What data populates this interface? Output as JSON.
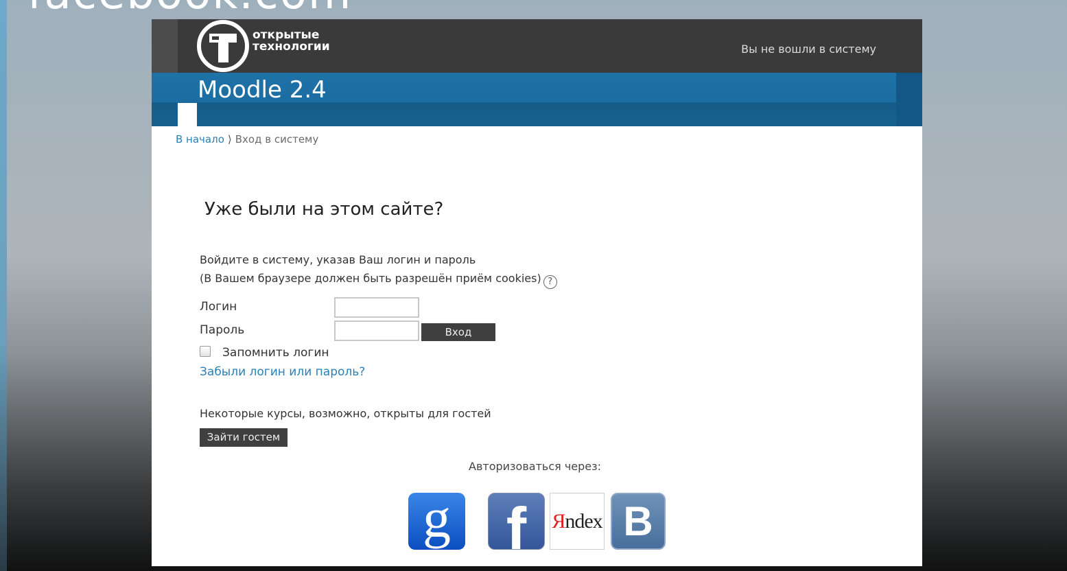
{
  "background": {
    "top_text": "facebook.com"
  },
  "header": {
    "logo_text_line1": "открытые",
    "logo_text_line2": "технологии",
    "login_status": "Вы не вошли в систему"
  },
  "banner": {
    "title": "Moodle 2.4"
  },
  "breadcrumb": {
    "home": "В начало",
    "separator": "⟩",
    "current": "Вход в систему"
  },
  "login": {
    "heading": "Уже были на этом сайте?",
    "desc_line1": "Войдите в систему, указав Ваш логин и пароль",
    "desc_line2": "(В Вашем браузере должен быть разрешён приём cookies)",
    "help_glyph": "?",
    "username_label": "Логин",
    "username_value": "",
    "password_label": "Пароль",
    "password_value": "",
    "submit_label": "Вход",
    "remember_label": "Запомнить логин",
    "remember_checked": false,
    "forgot_link": "Забыли логин или пароль?"
  },
  "guest": {
    "text": "Некоторые курсы, возможно, открыты для гостей",
    "button_label": "Зайти гостем"
  },
  "auth": {
    "text": "Авторизоваться через:",
    "providers": [
      {
        "name": "google-icon",
        "glyph": "g"
      },
      {
        "name": "facebook-icon",
        "glyph": "f"
      },
      {
        "name": "yandex-icon",
        "glyph_red": "Я",
        "glyph_rest": "ndex"
      },
      {
        "name": "vkontakte-icon",
        "glyph": "B"
      }
    ]
  },
  "colors": {
    "header_bg": "#3a3a3a",
    "banner_bg": "#1e72a8",
    "link": "#2a80b9",
    "button_bg": "#3f3f3f"
  }
}
